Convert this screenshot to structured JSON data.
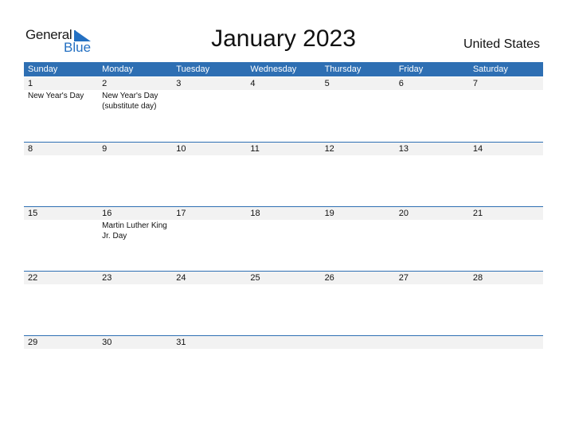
{
  "logo": {
    "general": "General",
    "blue": "Blue"
  },
  "title": "January 2023",
  "country": "United States",
  "weekdays": [
    "Sunday",
    "Monday",
    "Tuesday",
    "Wednesday",
    "Thursday",
    "Friday",
    "Saturday"
  ],
  "weeks": [
    [
      {
        "day": "1",
        "holiday": "New Year's Day"
      },
      {
        "day": "2",
        "holiday": "New Year's Day (substitute day)"
      },
      {
        "day": "3",
        "holiday": ""
      },
      {
        "day": "4",
        "holiday": ""
      },
      {
        "day": "5",
        "holiday": ""
      },
      {
        "day": "6",
        "holiday": ""
      },
      {
        "day": "7",
        "holiday": ""
      }
    ],
    [
      {
        "day": "8",
        "holiday": ""
      },
      {
        "day": "9",
        "holiday": ""
      },
      {
        "day": "10",
        "holiday": ""
      },
      {
        "day": "11",
        "holiday": ""
      },
      {
        "day": "12",
        "holiday": ""
      },
      {
        "day": "13",
        "holiday": ""
      },
      {
        "day": "14",
        "holiday": ""
      }
    ],
    [
      {
        "day": "15",
        "holiday": ""
      },
      {
        "day": "16",
        "holiday": "Martin Luther King Jr. Day"
      },
      {
        "day": "17",
        "holiday": ""
      },
      {
        "day": "18",
        "holiday": ""
      },
      {
        "day": "19",
        "holiday": ""
      },
      {
        "day": "20",
        "holiday": ""
      },
      {
        "day": "21",
        "holiday": ""
      }
    ],
    [
      {
        "day": "22",
        "holiday": ""
      },
      {
        "day": "23",
        "holiday": ""
      },
      {
        "day": "24",
        "holiday": ""
      },
      {
        "day": "25",
        "holiday": ""
      },
      {
        "day": "26",
        "holiday": ""
      },
      {
        "day": "27",
        "holiday": ""
      },
      {
        "day": "28",
        "holiday": ""
      }
    ],
    [
      {
        "day": "29",
        "holiday": ""
      },
      {
        "day": "30",
        "holiday": ""
      },
      {
        "day": "31",
        "holiday": ""
      },
      {
        "day": "",
        "holiday": ""
      },
      {
        "day": "",
        "holiday": ""
      },
      {
        "day": "",
        "holiday": ""
      },
      {
        "day": "",
        "holiday": ""
      }
    ]
  ]
}
